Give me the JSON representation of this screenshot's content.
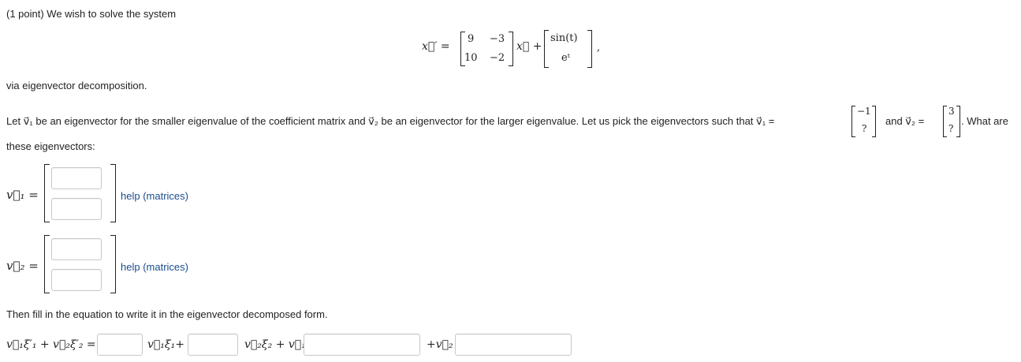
{
  "problem": {
    "header": "(1 point) We wish to solve the system",
    "system": {
      "lhs": "x⃗′ =",
      "matrix": [
        [
          "9",
          "−3"
        ],
        [
          "10",
          "−2"
        ]
      ],
      "x_term": "x⃗ +",
      "forcing": [
        "sin(t)",
        "eᵗ"
      ],
      "trailing": ","
    },
    "method_text": "via eigenvector decomposition.",
    "instruction_part1": "Let v⃗₁ be an eigenvector for the smaller eigenvalue of the coefficient matrix and v⃗₂ be an eigenvector for the larger eigenvalue. Let us pick the eigenvectors such that v⃗₁ =",
    "v1_given": [
      "−1",
      "?"
    ],
    "and_v2": "and v⃗₂ =",
    "v2_given": [
      "3",
      "?"
    ],
    "what_are": ". What are",
    "instruction_part2": "these eigenvectors:"
  },
  "answers": {
    "v1_label": "v⃗₁ =",
    "v2_label": "v⃗₂ =",
    "v1_entries": [
      "",
      ""
    ],
    "v2_entries": [
      "",
      ""
    ],
    "help_link": "help (matrices)"
  },
  "decomposition": {
    "intro": "Then fill in the equation to write it in the eigenvector decomposed form.",
    "lhs": "v⃗₁ξ′₁ + v⃗₂ξ′₂ =",
    "term1": "v⃗₁ξ₁+",
    "term2": "v⃗₂ξ₂ + v⃗₁",
    "term3": "+v⃗₂",
    "inputs": [
      "",
      "",
      "",
      ""
    ]
  }
}
